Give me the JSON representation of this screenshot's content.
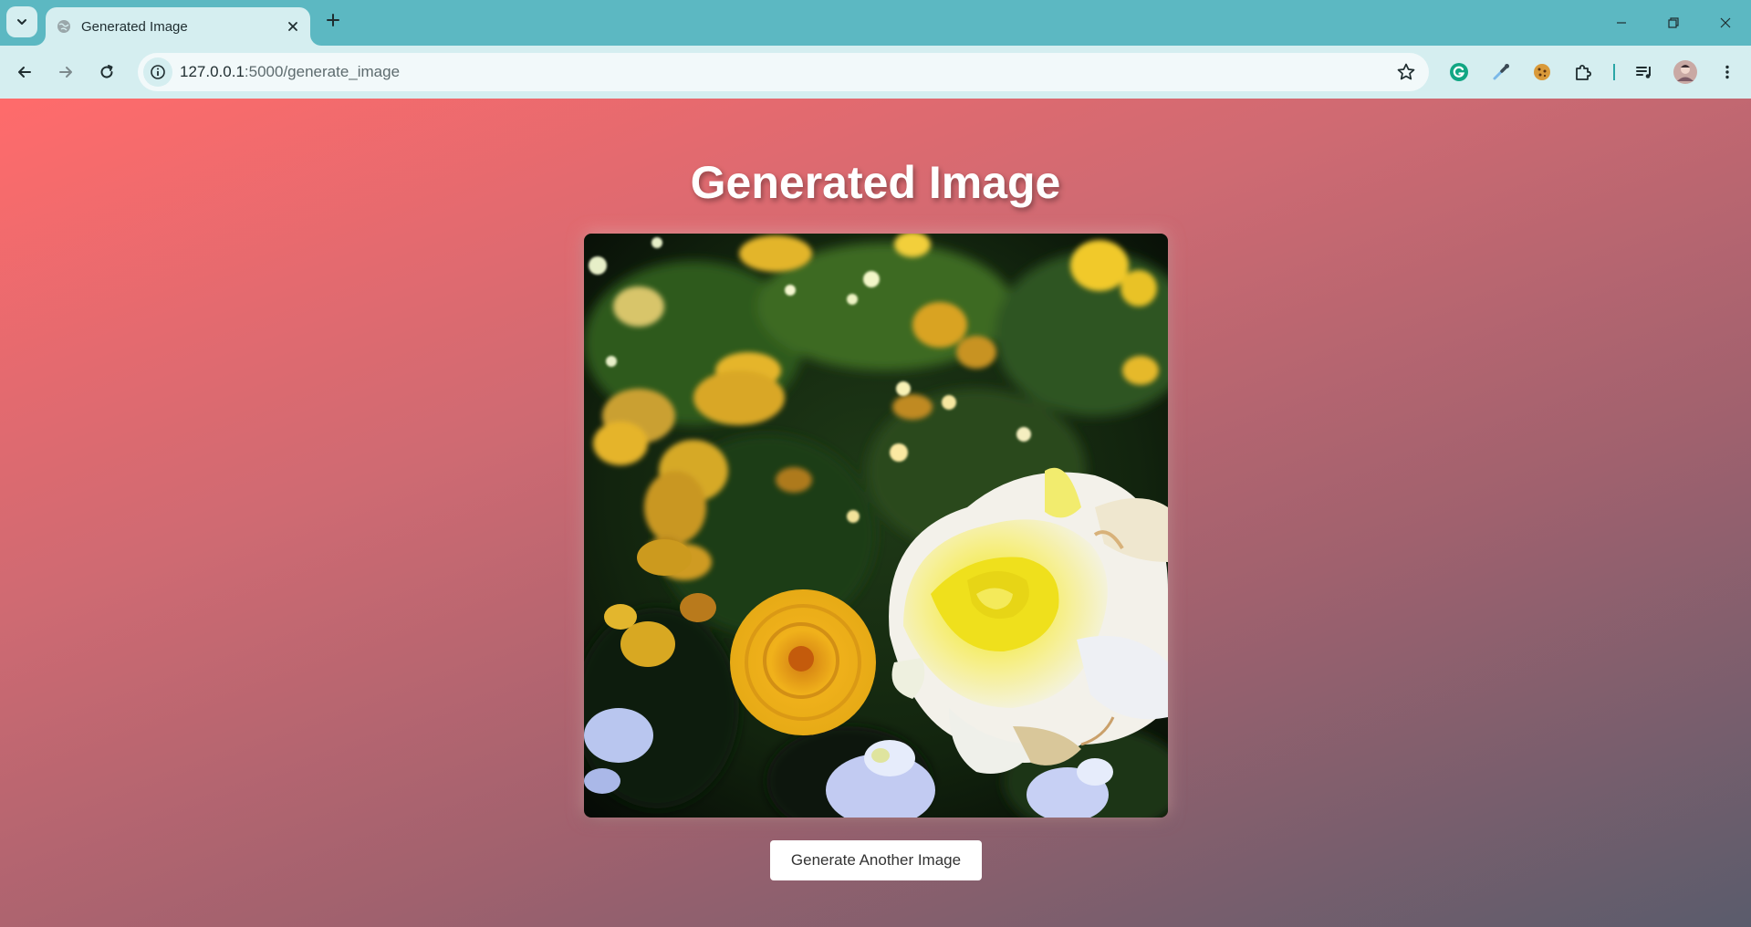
{
  "browser": {
    "tab": {
      "title": "Generated Image",
      "favicon": "globe-icon"
    },
    "address_bar": {
      "host": "127.0.0.1",
      "path": ":5000/generate_image"
    },
    "toolbar_icons": [
      "back-icon",
      "forward-icon",
      "reload-icon",
      "site-info-icon",
      "bookmark-star-icon",
      "grammarly-icon",
      "eyedropper-icon",
      "cookie-icon",
      "extensions-puzzle-icon",
      "media-queue-icon",
      "profile-avatar",
      "menu-kebab-icon"
    ],
    "window_controls": [
      "minimize-icon",
      "restore-icon",
      "close-icon"
    ],
    "colors": {
      "tabstrip": "#5cb8c2",
      "toolbar": "#d5eef0"
    }
  },
  "page": {
    "heading": "Generated Image",
    "image": {
      "description_icon": "generated-flower-image"
    },
    "button_label": "Generate Another Image",
    "colors": {
      "gradient_start": "#ff6b6b",
      "gradient_end": "#5a5c6c"
    }
  }
}
